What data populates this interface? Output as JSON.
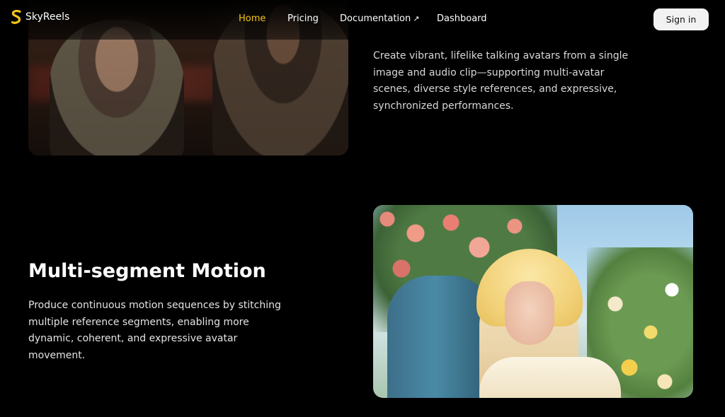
{
  "brand": {
    "name": "SkyReels",
    "accent_color": "#f5c518",
    "logo_icon": "s-logo-icon"
  },
  "nav": {
    "items": [
      {
        "label": "Home",
        "active": true
      },
      {
        "label": "Pricing",
        "active": false
      },
      {
        "label": "Documentation",
        "external": true,
        "icon": "external-arrow-icon",
        "arrow": "↗"
      },
      {
        "label": "Dashboard",
        "active": false
      }
    ],
    "signin_label": "Sign in"
  },
  "top_section": {
    "description": "Create vibrant, lifelike talking avatars from a single image and audio clip—supporting multi-avatar scenes, diverse style references, and expressive, synchronized performances."
  },
  "multi_segment": {
    "title": "Multi-segment Motion",
    "description": "Produce continuous motion sequences by stitching multiple reference segments, enabling more dynamic, coherent, and expressive avatar movement."
  }
}
